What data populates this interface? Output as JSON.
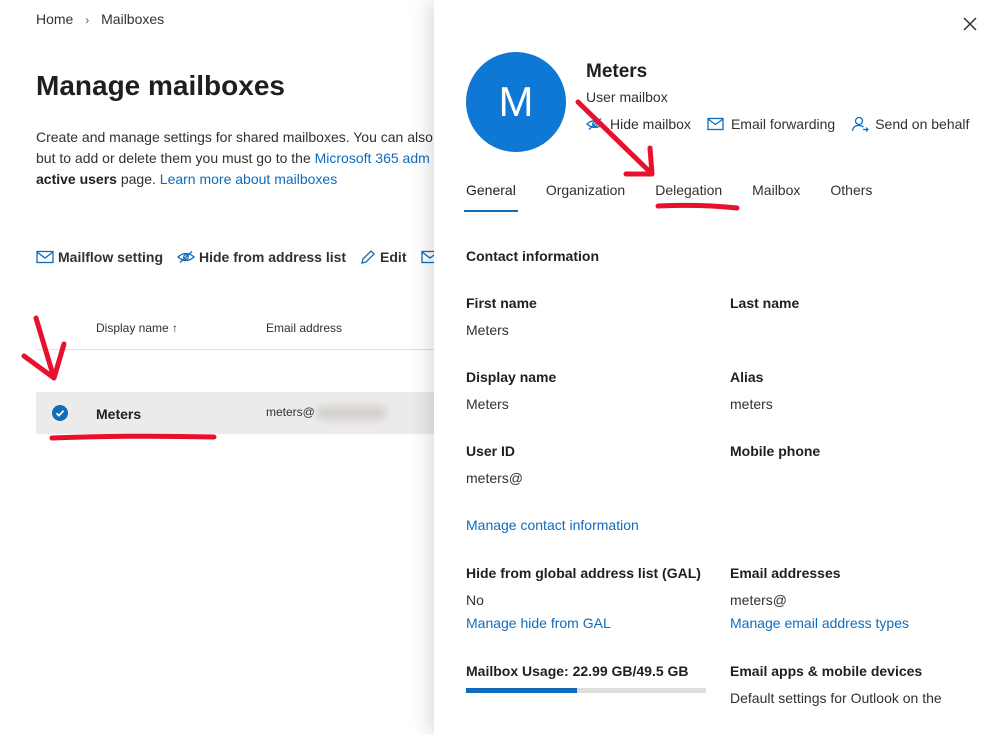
{
  "breadcrumb": {
    "home": "Home",
    "current": "Mailboxes"
  },
  "page": {
    "title": "Manage mailboxes",
    "desc_line1": "Create and manage settings for shared mailboxes. You can also m",
    "desc_line2_a": "but to add or delete them you must go to the ",
    "desc_line2_link": "Microsoft 365 adm",
    "desc_line3_bold": "active users",
    "desc_line3_mid": " page. ",
    "desc_line3_link": "Learn more about mailboxes"
  },
  "commands": {
    "mailflow": "Mailflow setting",
    "hide": "Hide from address list",
    "edit": "Edit"
  },
  "table": {
    "col_name": "Display name ↑",
    "col_email": "Email address",
    "row": {
      "name": "Meters",
      "email": "meters@"
    }
  },
  "panel": {
    "avatar_letter": "M",
    "name": "Meters",
    "type": "User mailbox",
    "actions": {
      "hide": "Hide mailbox",
      "forward": "Email forwarding",
      "send_behalf": "Send on behalf"
    },
    "tabs": [
      "General",
      "Organization",
      "Delegation",
      "Mailbox",
      "Others"
    ],
    "section": "Contact information",
    "fields": {
      "first_name_label": "First name",
      "first_name_value": "Meters",
      "last_name_label": "Last name",
      "display_name_label": "Display name",
      "display_name_value": "Meters",
      "alias_label": "Alias",
      "alias_value": "meters",
      "user_id_label": "User ID",
      "user_id_value": "meters@",
      "mobile_label": "Mobile phone",
      "manage_contact": "Manage contact information",
      "gal_label": "Hide from global address list (GAL)",
      "gal_value": "No",
      "manage_gal": "Manage hide from GAL",
      "email_addr_label": "Email addresses",
      "email_addr_value": "meters@",
      "manage_email_types": "Manage email address types",
      "usage_label": "Mailbox Usage: 22.99 GB/49.5 GB",
      "usage_used_gb": 22.99,
      "usage_total_gb": 49.5,
      "apps_label": "Email apps & mobile devices",
      "apps_value": "Default settings for Outlook on the"
    }
  },
  "colors": {
    "accent": "#0f6cbd",
    "annotation": "#e8112d",
    "avatar": "#0f78d4"
  }
}
